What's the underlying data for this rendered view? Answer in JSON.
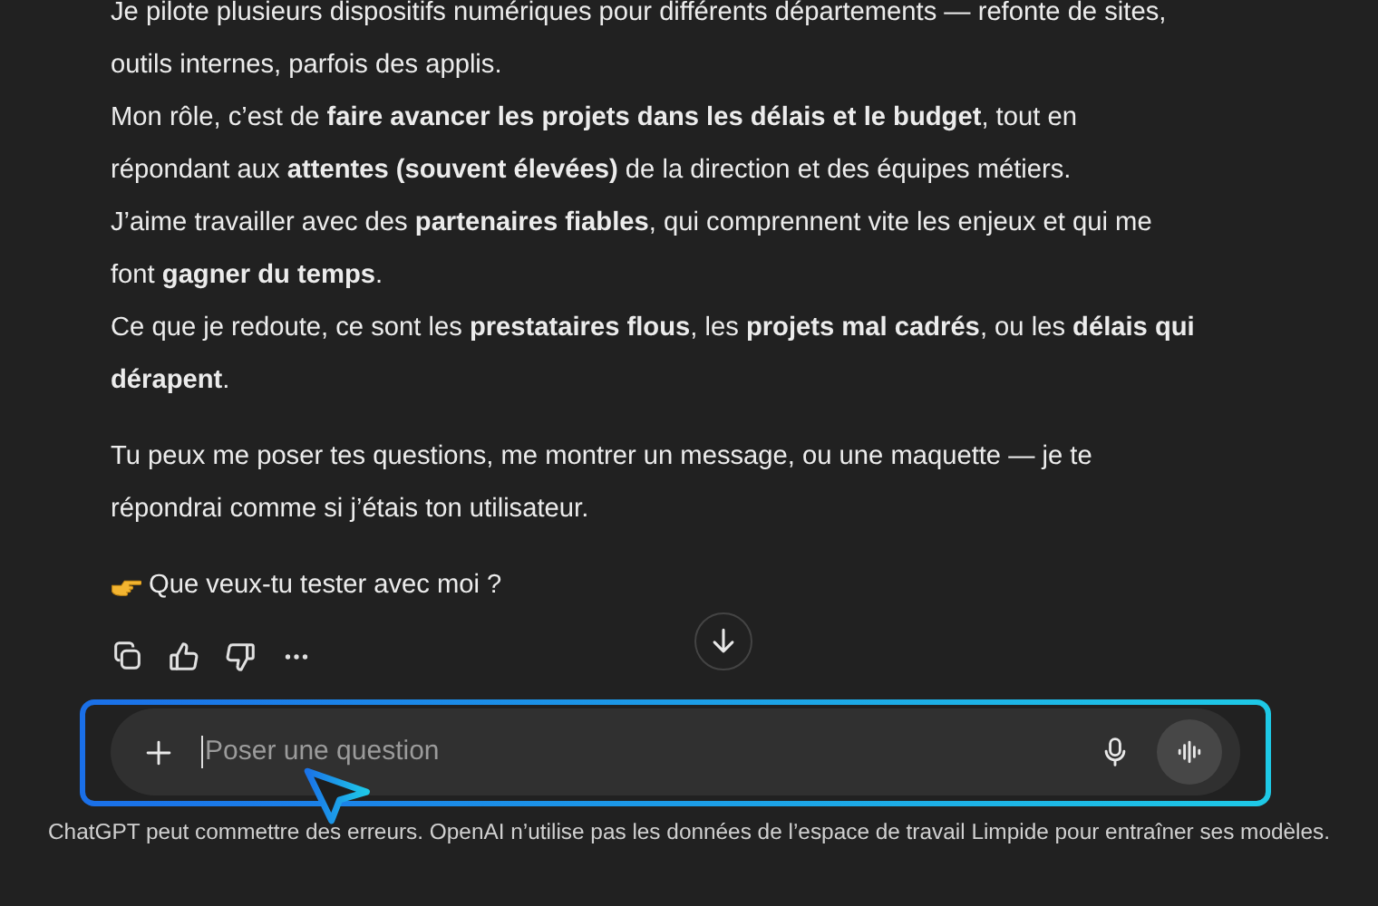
{
  "message": {
    "paragraphs": [
      [
        "Je pilote plusieurs dispositifs numériques pour différents départements — refonte de sites, outils internes, parfois des applis.",
        "Mon rôle, c’est de **faire avancer les projets dans les délais et le budget**, tout en répondant aux **attentes (souvent élevées)** de la direction et des équipes métiers.",
        "J’aime travailler avec des **partenaires fiables**, qui comprennent vite les enjeux et qui me font **gagner du temps**.",
        "Ce que je redoute, ce sont les **prestataires flous**, les **projets mal cadrés**, ou les **délais qui dérapent**."
      ],
      [
        "Tu peux me poser tes questions, me montrer un message, ou une maquette — je te répondrai comme si j’étais ton utilisateur."
      ],
      [
        "Que veux-tu tester avec moi ?"
      ]
    ]
  },
  "composer": {
    "placeholder": "Poser une question",
    "highlighted": true
  },
  "footer": "ChatGPT peut commettre des erreurs. OpenAI n’utilise pas les données de l’espace de travail Limpide pour entraîner ses modèles."
}
